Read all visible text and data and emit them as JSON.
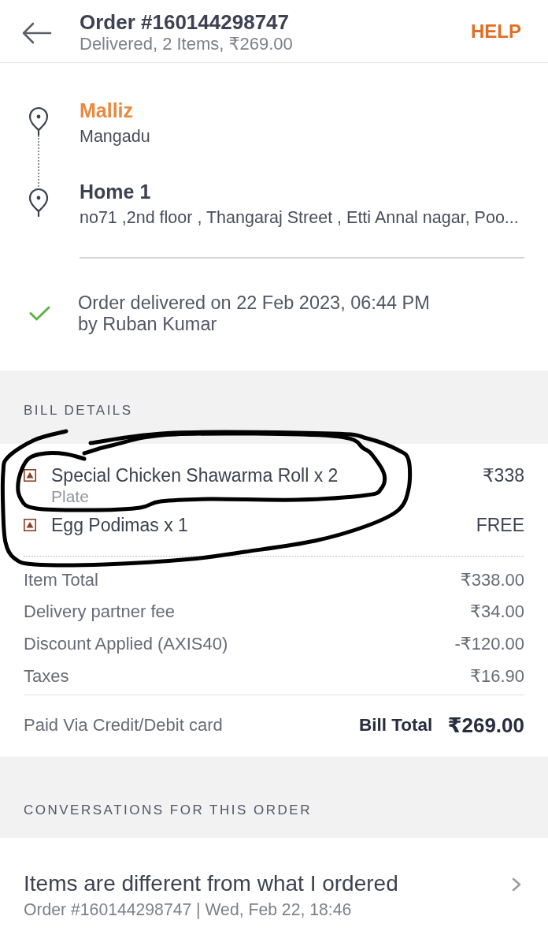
{
  "header": {
    "title": "Order #160144298747",
    "subtitle": "Delivered, 2 Items, ₹269.00",
    "help": "HELP"
  },
  "route": {
    "stops": [
      {
        "kind": "restaurant",
        "name": "Malliz",
        "detail": "Mangadu"
      },
      {
        "kind": "address",
        "name": "Home 1",
        "detail": "no71 ,2nd floor , Thangaraj Street , Etti Annal nagar, Poo..."
      }
    ]
  },
  "delivery": {
    "delivered": true,
    "message": "Order delivered on 22 Feb 2023, 06:44 PM",
    "agent": "by Ruban Kumar"
  },
  "bill": {
    "title": "BILL DETAILS",
    "items": [
      {
        "non_veg": true,
        "name": "Special Chicken Shawarma Roll x 2",
        "variant": "Plate",
        "price": "₹338"
      },
      {
        "non_veg": true,
        "name": "Egg Podimas x 1",
        "price": "FREE"
      }
    ],
    "charges": [
      {
        "label": "Item Total",
        "amount": "₹338.00"
      },
      {
        "label": "Delivery partner fee",
        "amount": "₹34.00"
      },
      {
        "label": "Discount Applied (AXIS40)",
        "amount": "-₹120.00"
      },
      {
        "label": "Taxes",
        "amount": "₹16.90"
      }
    ],
    "payment": "Paid Via Credit/Debit card",
    "total_label": "Bill Total",
    "total": "₹269.00"
  },
  "conversations": {
    "title": "CONVERSATIONS FOR THIS ORDER",
    "items": [
      {
        "title": "Items are different from what I ordered",
        "meta": "Order #160144298747 | Wed, Feb 22, 18:46"
      }
    ]
  }
}
